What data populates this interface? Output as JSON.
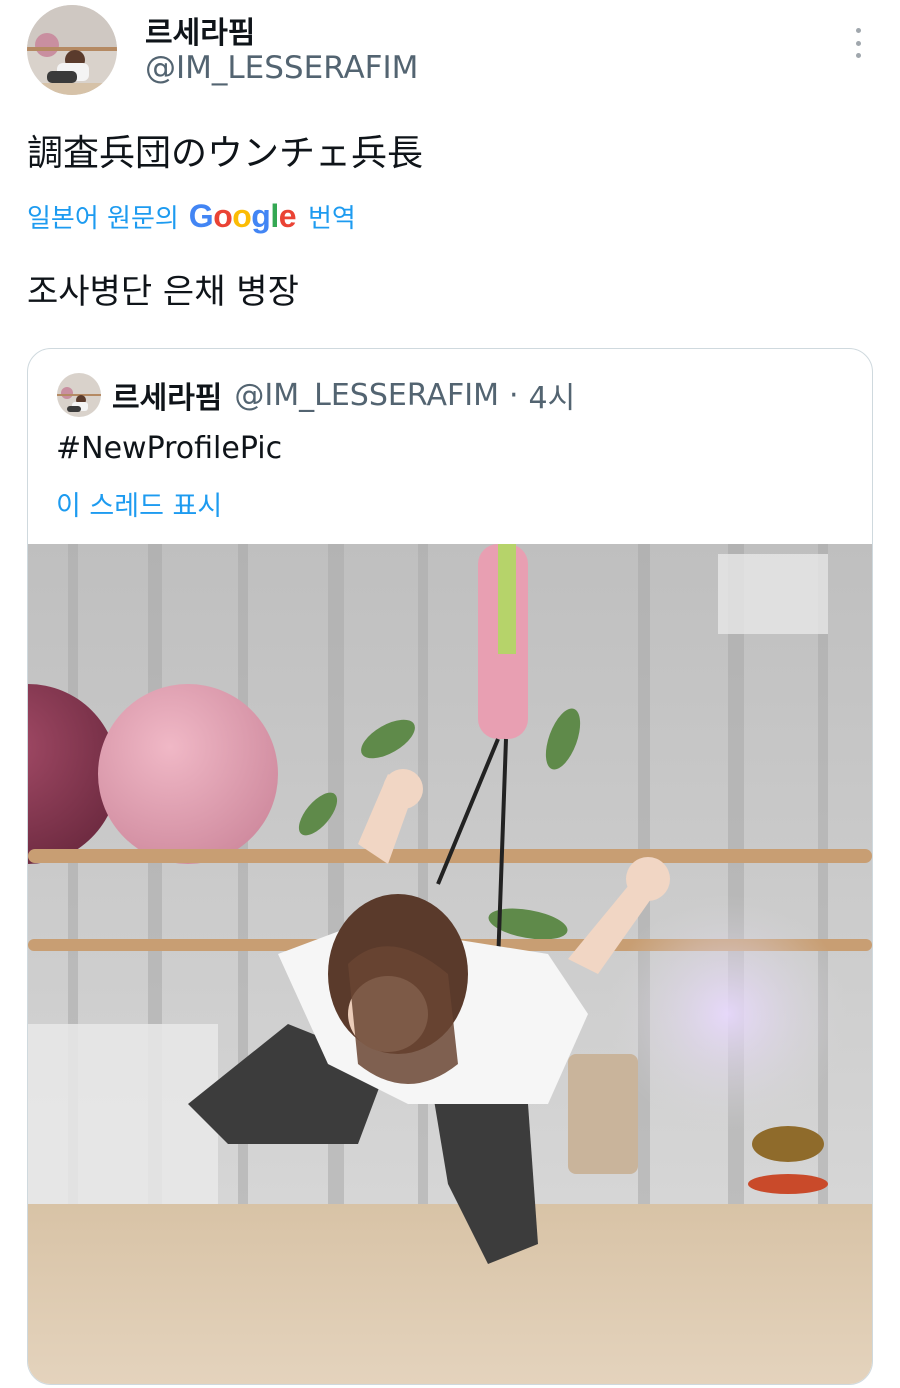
{
  "tweet": {
    "display_name": "르세라핌",
    "handle": "@IM_LESSERAFIM",
    "text": "調査兵団のウンチェ兵長",
    "translate_label": "일본어 원문의",
    "translate_brand": "Google",
    "translate_suffix": "번역",
    "translated_text": "조사병단 은채 병장",
    "more_icon": "more-vertical-icon"
  },
  "quote": {
    "display_name": "르세라핌",
    "handle": "@IM_LESSERAFIM",
    "separator": "·",
    "time": "4시",
    "text": "#NewProfilePic",
    "thread_link": "이 스레드 표시"
  },
  "colors": {
    "link": "#1d9bf0",
    "secondary_text": "#536471",
    "border": "#cfd9de",
    "google_blue": "#4285F4",
    "google_red": "#EA4335",
    "google_yellow": "#FBBC05",
    "google_green": "#34A853"
  }
}
